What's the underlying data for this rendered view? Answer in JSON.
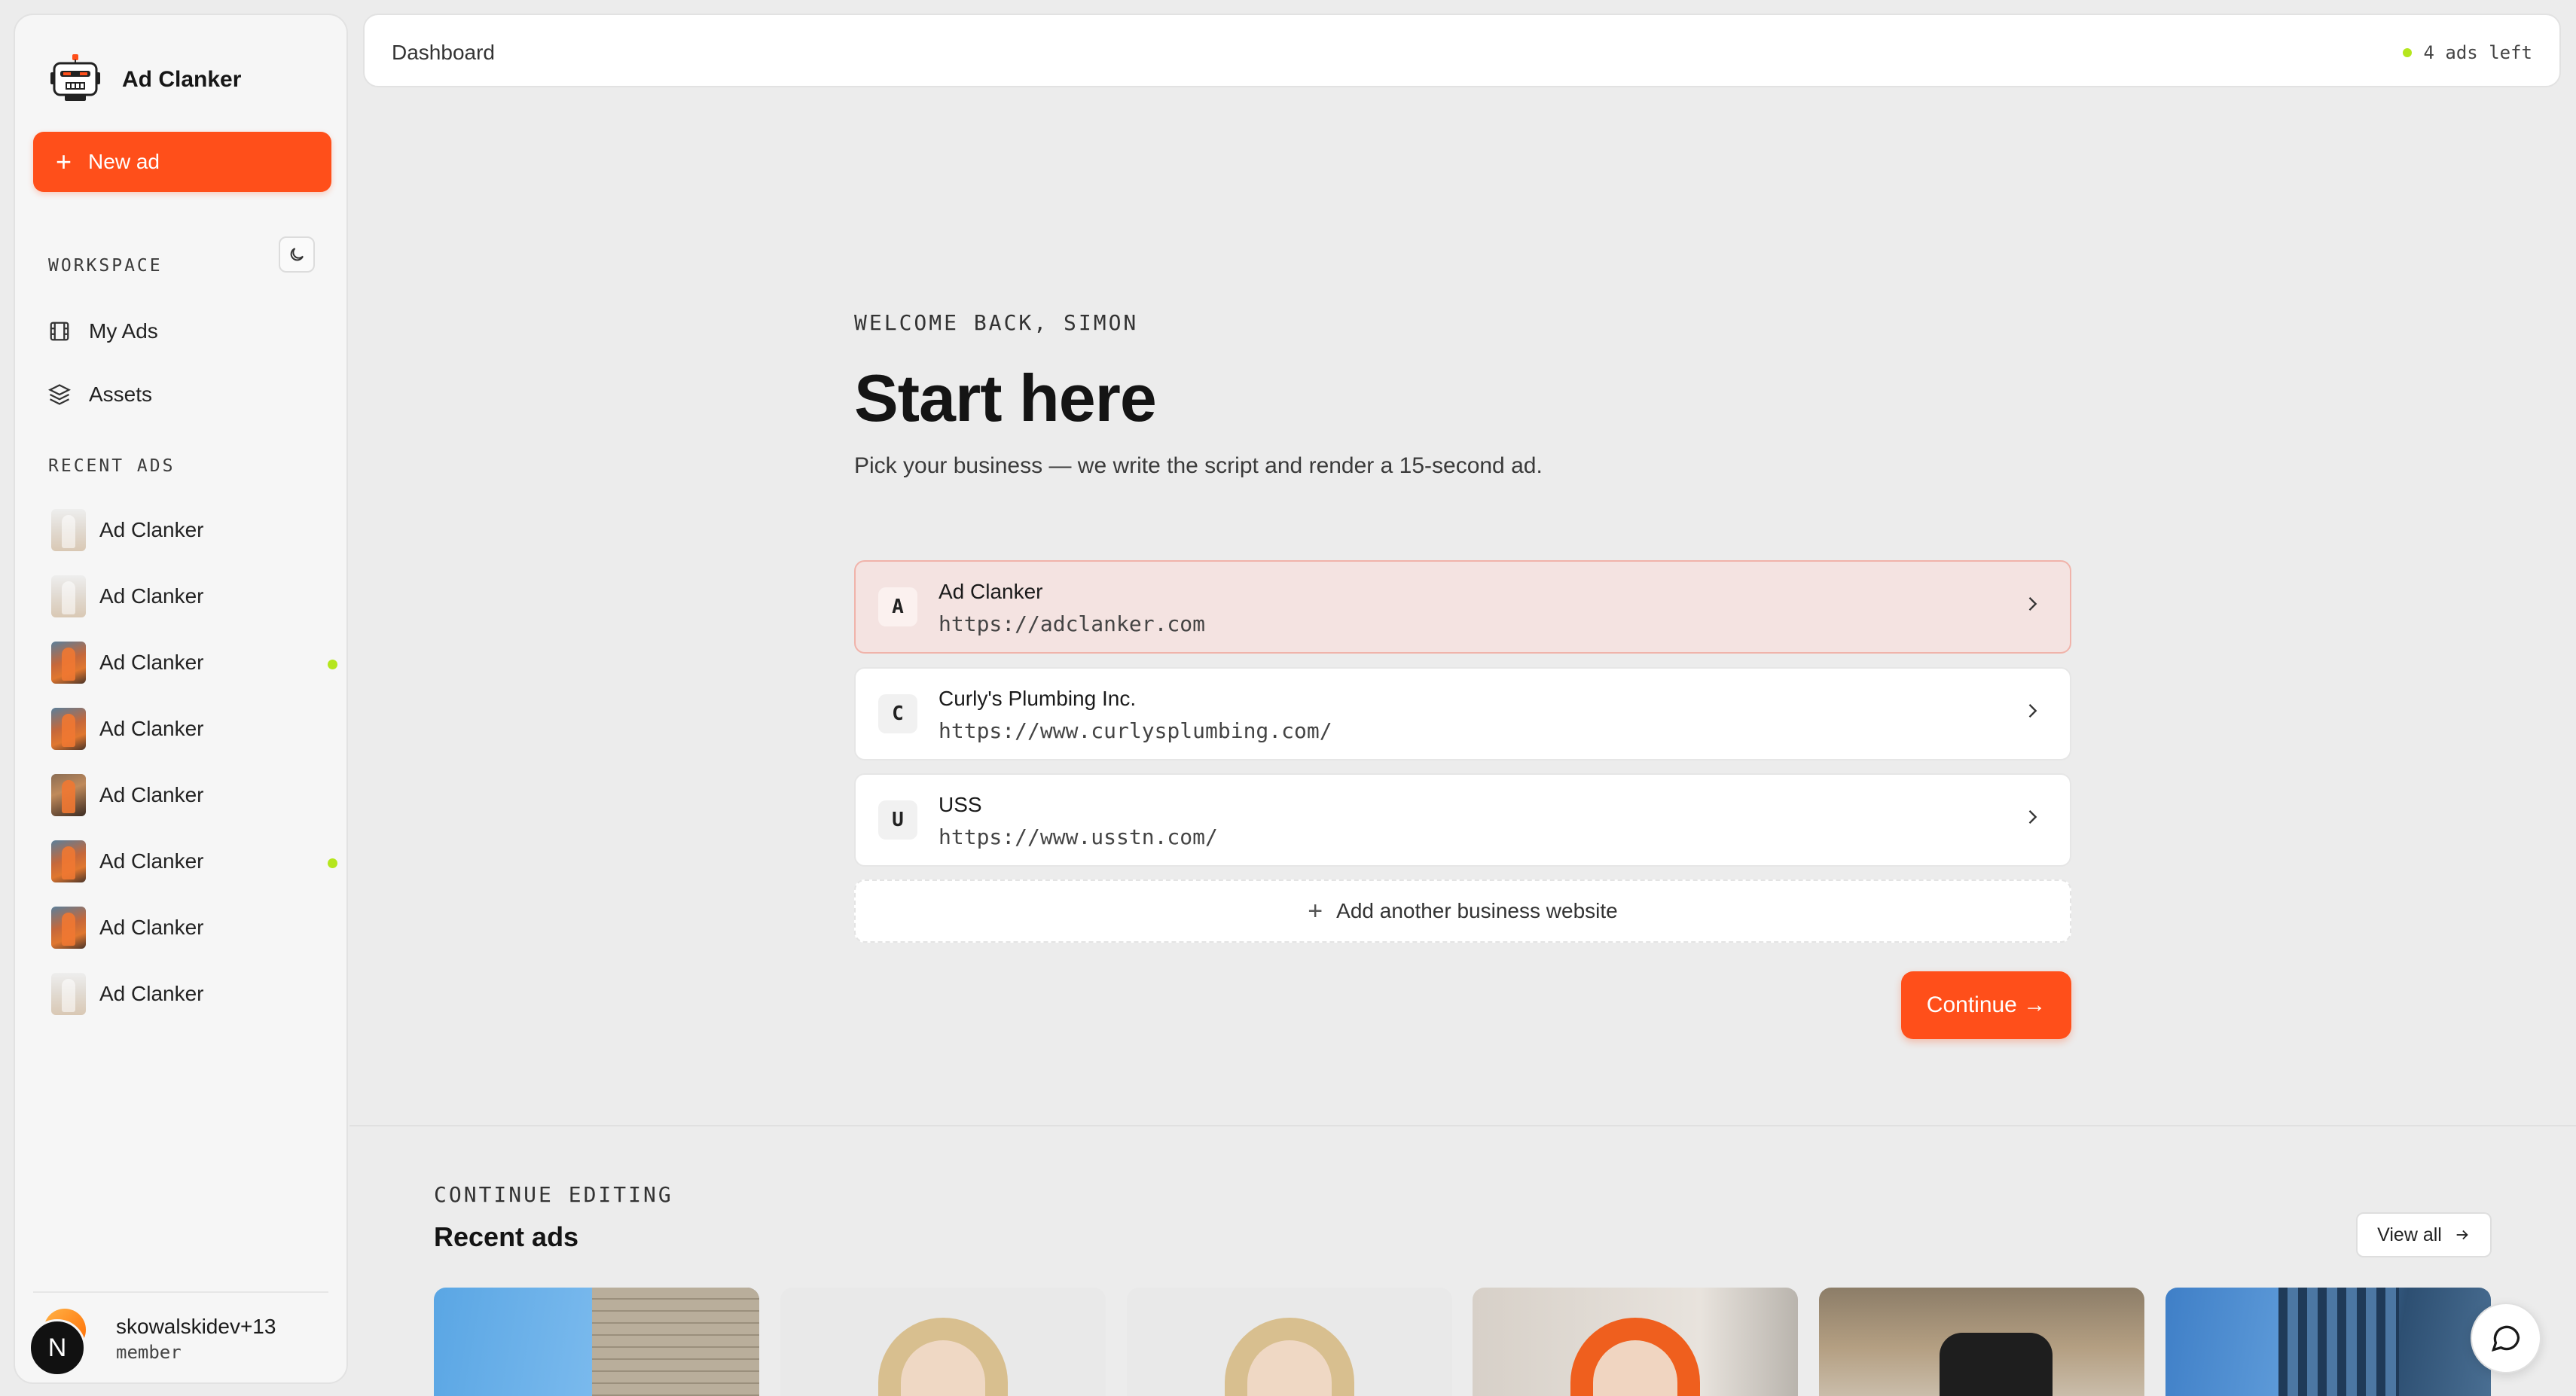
{
  "app": {
    "name": "Ad Clanker"
  },
  "sidebar": {
    "new_ad_label": "New ad",
    "workspace_label": "WORKSPACE",
    "nav": [
      {
        "label": "My Ads",
        "icon": "film-icon"
      },
      {
        "label": "Assets",
        "icon": "layers-icon"
      }
    ],
    "recent_label": "RECENT ADS",
    "recent_ads": [
      {
        "label": "Ad Clanker",
        "thumb": "light",
        "live": false
      },
      {
        "label": "Ad Clanker",
        "thumb": "light",
        "live": false
      },
      {
        "label": "Ad Clanker",
        "thumb": "orange",
        "live": true
      },
      {
        "label": "Ad Clanker",
        "thumb": "orange",
        "live": false
      },
      {
        "label": "Ad Clanker",
        "thumb": "brown",
        "live": false
      },
      {
        "label": "Ad Clanker",
        "thumb": "orange",
        "live": true
      },
      {
        "label": "Ad Clanker",
        "thumb": "orange",
        "live": false
      },
      {
        "label": "Ad Clanker",
        "thumb": "light",
        "live": false
      }
    ],
    "user": {
      "initial": "N",
      "name": "skowalskidev+13",
      "role": "member"
    }
  },
  "topbar": {
    "title": "Dashboard",
    "ads_left": "4 ads left"
  },
  "hero": {
    "welcome": "WELCOME BACK, SIMON",
    "headline": "Start here",
    "subline": "Pick your business — we write the script and render a 15-second ad."
  },
  "businesses": [
    {
      "letter": "A",
      "name": "Ad Clanker",
      "url": "https://adclanker.com",
      "selected": true
    },
    {
      "letter": "C",
      "name": "Curly's Plumbing Inc.",
      "url": "https://www.curlysplumbing.com/",
      "selected": false
    },
    {
      "letter": "U",
      "name": "USS",
      "url": "https://www.usstn.com/",
      "selected": false
    }
  ],
  "add_business_label": "Add another business website",
  "continue_label": "Continue →",
  "recent_section": {
    "eyebrow": "CONTINUE EDITING",
    "title": "Recent ads",
    "view_all_label": "View all"
  },
  "colors": {
    "accent": "#ff4f1a",
    "live": "#b5e61d",
    "selected_bg": "#f4e3e1"
  }
}
